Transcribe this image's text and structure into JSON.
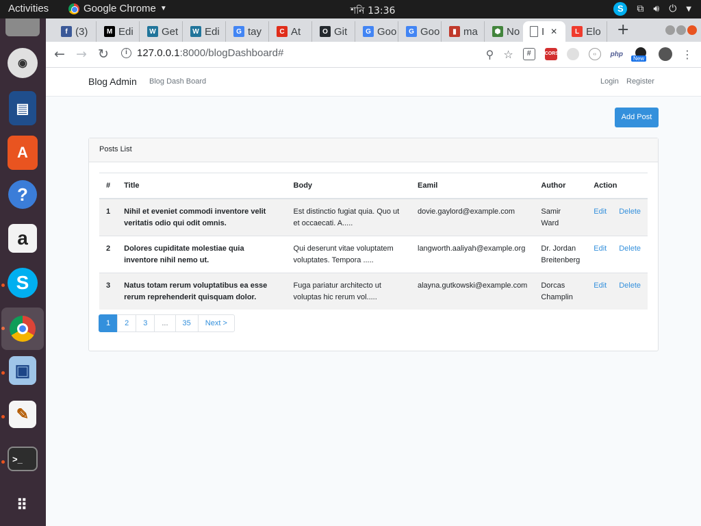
{
  "topbar": {
    "activities": "Activities",
    "app_name": "Google Chrome",
    "clock": "শনি 13:36"
  },
  "tabs": [
    {
      "label": "(3)",
      "icon": "facebook-icon",
      "color": "#3b5998",
      "glyph": "f"
    },
    {
      "label": "Edi",
      "icon": "medium-icon",
      "color": "#000000",
      "glyph": "M"
    },
    {
      "label": "Get",
      "icon": "wordpress-icon",
      "color": "#21759b",
      "glyph": "W"
    },
    {
      "label": "Edi",
      "icon": "wordpress-icon",
      "color": "#21759b",
      "glyph": "W"
    },
    {
      "label": "tay",
      "icon": "google-icon",
      "color": "#4285f4",
      "glyph": "G"
    },
    {
      "label": "At",
      "icon": "codecademy-icon",
      "color": "#e02d1a",
      "glyph": "C"
    },
    {
      "label": "Git",
      "icon": "github-icon",
      "color": "#24292e",
      "glyph": "O"
    },
    {
      "label": "Goo",
      "icon": "google-translate-icon",
      "color": "#4285f4",
      "glyph": "G"
    },
    {
      "label": "Goo",
      "icon": "google-translate-icon",
      "color": "#4285f4",
      "glyph": "G"
    },
    {
      "label": "ma",
      "icon": "bookmark-red-icon",
      "color": "#c0392b",
      "glyph": "▮"
    },
    {
      "label": "No",
      "icon": "nodejs-icon",
      "color": "#43853d",
      "glyph": "⬢"
    },
    {
      "label": "I",
      "icon": "document-icon",
      "color": "#ffffff",
      "glyph": ""
    },
    {
      "label": "Elo",
      "icon": "laravel-icon",
      "color": "#ef3b2d",
      "glyph": "L"
    }
  ],
  "toolbar": {
    "url_host": "127.0.0.1",
    "url_path": ":8000/blogDashboard#",
    "ext_cors": "CORS",
    "ext_php": "php",
    "ext_new": "New"
  },
  "navbar": {
    "brand": "Blog Admin",
    "dashboard_link": "Blog Dash Board",
    "login": "Login",
    "register": "Register"
  },
  "add_post": "Add Post",
  "card": {
    "title": "Posts List"
  },
  "table": {
    "headers": [
      "#",
      "Title",
      "Body",
      "Eamil",
      "Author",
      "Action"
    ],
    "rows": [
      {
        "num": "1",
        "title": "Nihil et eveniet commodi inventore velit veritatis odio qui odit omnis.",
        "body": "Est distinctio fugiat quia. Quo ut et occaecati. A.....",
        "email": "dovie.gaylord@example.com",
        "author": "Samir Ward",
        "edit": "Edit",
        "delete": "Delete"
      },
      {
        "num": "2",
        "title": "Dolores cupiditate molestiae quia inventore nihil nemo ut.",
        "body": "Qui deserunt vitae voluptatem voluptates. Tempora .....",
        "email": "langworth.aaliyah@example.org",
        "author": "Dr. Jordan Breitenberg",
        "edit": "Edit",
        "delete": "Delete"
      },
      {
        "num": "3",
        "title": "Natus totam rerum voluptatibus ea esse rerum reprehenderit quisquam dolor.",
        "body": "Fuga pariatur architecto ut voluptas hic rerum vol.....",
        "email": "alayna.gutkowski@example.com",
        "author": "Dorcas Champlin",
        "edit": "Edit",
        "delete": "Delete"
      }
    ]
  },
  "pagination": [
    "1",
    "2",
    "3",
    "...",
    "35",
    "Next >"
  ],
  "colors": {
    "primary": "#3490dc",
    "dock": "#3a2c38",
    "topbar": "#1d1d1d"
  }
}
